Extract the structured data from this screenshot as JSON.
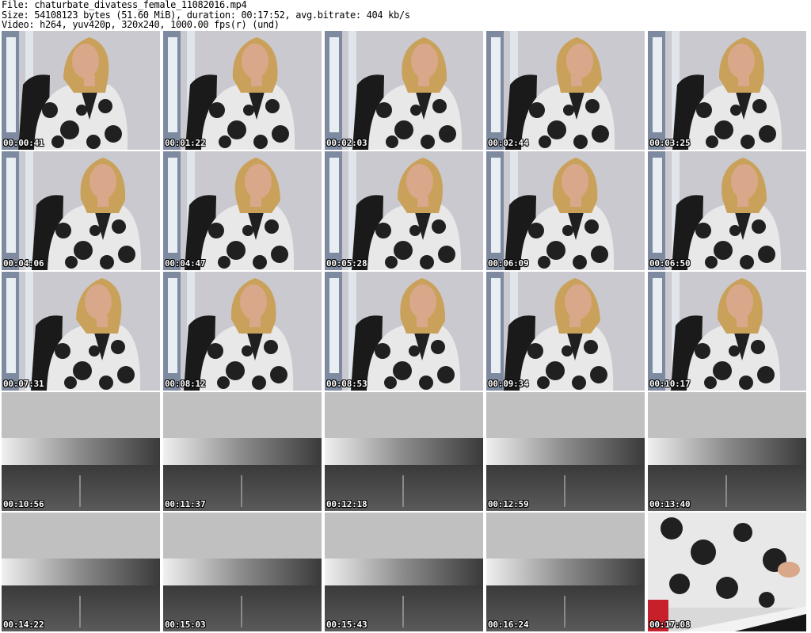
{
  "header": {
    "file_line": "File: chaturbate_divatess_female_11082016.mp4",
    "size_line": "Size: 54108123 bytes (51.60 MiB), duration: 00:17:52, avg.bitrate: 404 kb/s",
    "video_line": "Video: h264, yuv420p, 320x240, 1000.00 fps(r) (und)"
  },
  "colors": {
    "wall": "#c9c9cf",
    "window": "#e8eef2",
    "chair": "#1a1a1a",
    "hair": "#c9a15a",
    "skin": "#d9a88a",
    "blouse_light": "#e8e8e8",
    "blouse_dark": "#202020",
    "desk_top": "#c0c0c0",
    "desk_metal": "#7a7a7a",
    "desk_dark": "#2a2a2a"
  },
  "thumbnails": [
    {
      "time": "00:00:41",
      "scene": "person"
    },
    {
      "time": "00:01:22",
      "scene": "person"
    },
    {
      "time": "00:02:03",
      "scene": "person"
    },
    {
      "time": "00:02:44",
      "scene": "person"
    },
    {
      "time": "00:03:25",
      "scene": "person"
    },
    {
      "time": "00:04:06",
      "scene": "person"
    },
    {
      "time": "00:04:47",
      "scene": "person"
    },
    {
      "time": "00:05:28",
      "scene": "person"
    },
    {
      "time": "00:06:09",
      "scene": "person"
    },
    {
      "time": "00:06:50",
      "scene": "person"
    },
    {
      "time": "00:07:31",
      "scene": "person"
    },
    {
      "time": "00:08:12",
      "scene": "person"
    },
    {
      "time": "00:08:53",
      "scene": "person"
    },
    {
      "time": "00:09:34",
      "scene": "person"
    },
    {
      "time": "00:10:17",
      "scene": "person"
    },
    {
      "time": "00:10:56",
      "scene": "desk"
    },
    {
      "time": "00:11:37",
      "scene": "desk"
    },
    {
      "time": "00:12:18",
      "scene": "desk"
    },
    {
      "time": "00:12:59",
      "scene": "desk"
    },
    {
      "time": "00:13:40",
      "scene": "desk"
    },
    {
      "time": "00:14:22",
      "scene": "desk"
    },
    {
      "time": "00:15:03",
      "scene": "desk"
    },
    {
      "time": "00:15:43",
      "scene": "desk"
    },
    {
      "time": "00:16:24",
      "scene": "desk"
    },
    {
      "time": "00:17:08",
      "scene": "closeup"
    }
  ]
}
